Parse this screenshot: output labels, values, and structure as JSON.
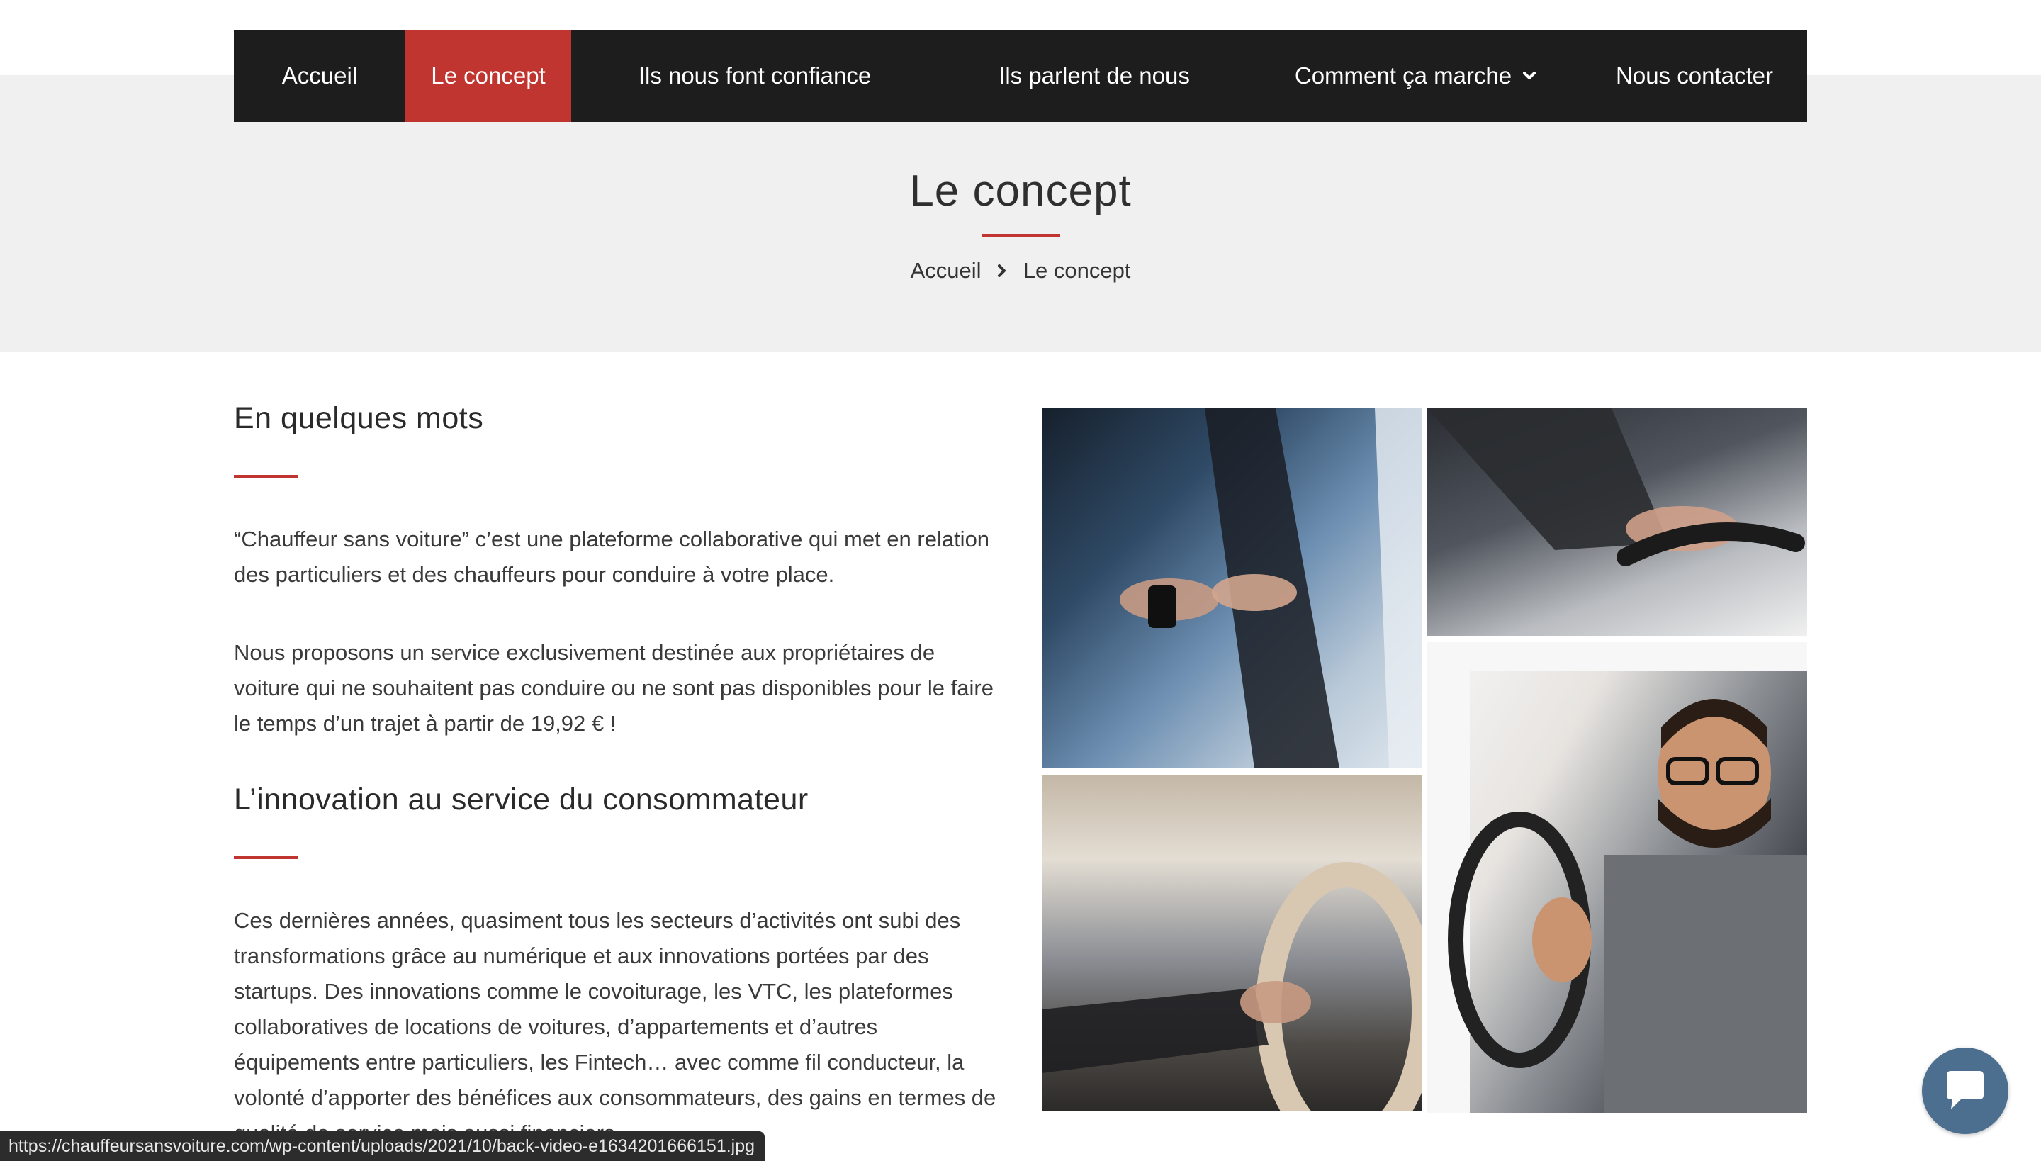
{
  "nav": {
    "items": [
      {
        "label": "Accueil"
      },
      {
        "label": "Le concept"
      },
      {
        "label": "Ils nous font confiance"
      },
      {
        "label": "Ils parlent de nous"
      },
      {
        "label": "Comment ça marche"
      },
      {
        "label": "Nous contacter"
      }
    ],
    "active_index": 1,
    "accent_color": "#c0352f",
    "background_color": "#1d1d1d"
  },
  "hero": {
    "title": "Le concept",
    "breadcrumb": {
      "home": "Accueil",
      "current": "Le concept"
    }
  },
  "sections": [
    {
      "heading": "En quelques mots",
      "paragraphs": [
        "“Chauffeur sans voiture” c’est une plateforme collaborative qui met en relation des particuliers et des chauffeurs pour conduire à votre place.",
        "Nous proposons un service exclusivement destinée aux propriétaires de voiture qui ne souhaitent pas conduire ou ne sont pas disponibles pour le faire le temps d’un trajet à partir de 19,92 € !"
      ]
    },
    {
      "heading": "L’innovation au service du consommateur",
      "paragraphs": [
        "Ces dernières années, quasiment tous les secteurs d’activités ont subi des transformations grâce au numérique et aux innovations portées par des startups. Des innovations comme le covoiturage, les VTC, les plateformes collaboratives de locations de voitures, d’appartements et d’autres équipements entre particuliers, les Fintech… avec comme fil conducteur, la volonté d’apporter des bénéfices aux consommateurs, des gains en termes de qualité de service mais aussi financiers."
      ]
    }
  ],
  "status_bar": {
    "url": "https://chauffeursansvoiture.com/wp-content/uploads/2021/10/back-video-e1634201666151.jpg"
  },
  "icons": {
    "nav_dropdown": "chevron-down-icon",
    "breadcrumb_separator": "chevron-right-icon",
    "chat": "chat-bubble-icon"
  }
}
